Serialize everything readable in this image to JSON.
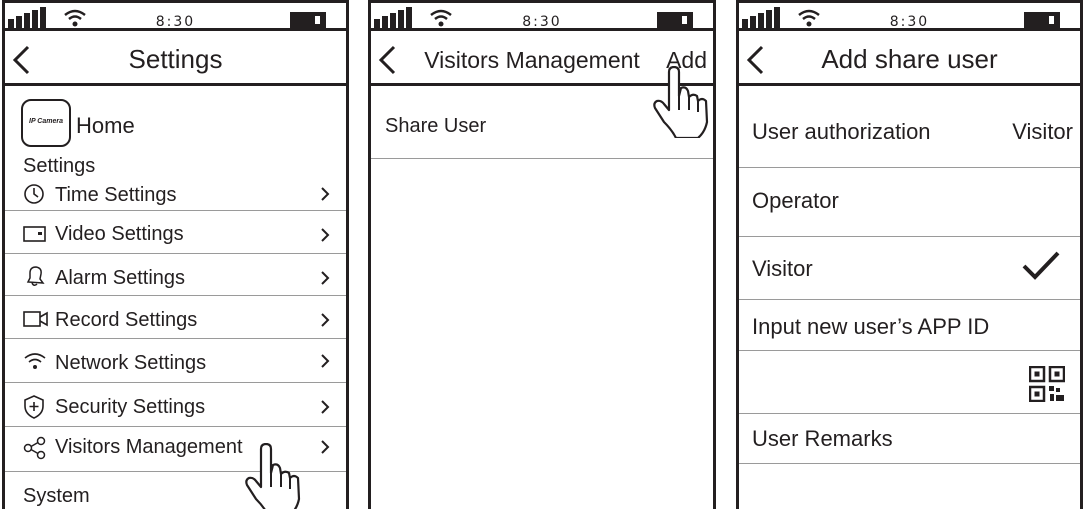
{
  "status_bar": {
    "time": "8:30"
  },
  "screen1": {
    "title": "Settings",
    "device": {
      "camera_label": "IP Camera",
      "name": "Home"
    },
    "section_settings": "Settings",
    "items": [
      {
        "label": "Time Settings",
        "icon": "clock-icon"
      },
      {
        "label": "Video Settings",
        "icon": "video-icon"
      },
      {
        "label": "Alarm Settings",
        "icon": "bell-icon"
      },
      {
        "label": "Record Settings",
        "icon": "record-icon"
      },
      {
        "label": "Network Settings",
        "icon": "wifi-icon"
      },
      {
        "label": "Security Settings",
        "icon": "shield-icon"
      },
      {
        "label": "Visitors Management",
        "icon": "share-icon"
      }
    ],
    "section_system": "System"
  },
  "screen2": {
    "title": "Visitors Management",
    "add_label": "Add",
    "items": [
      {
        "label": "Share User"
      }
    ]
  },
  "screen3": {
    "title": "Add share user",
    "authorization_label": "User authorization",
    "authorization_value": "Visitor",
    "option_operator": "Operator",
    "option_visitor": "Visitor",
    "app_id_label": "Input new user’s APP ID",
    "remarks_label": "User Remarks"
  },
  "colors": {
    "ink": "#231f20",
    "divider": "#9a9a9a",
    "background": "#ffffff"
  }
}
